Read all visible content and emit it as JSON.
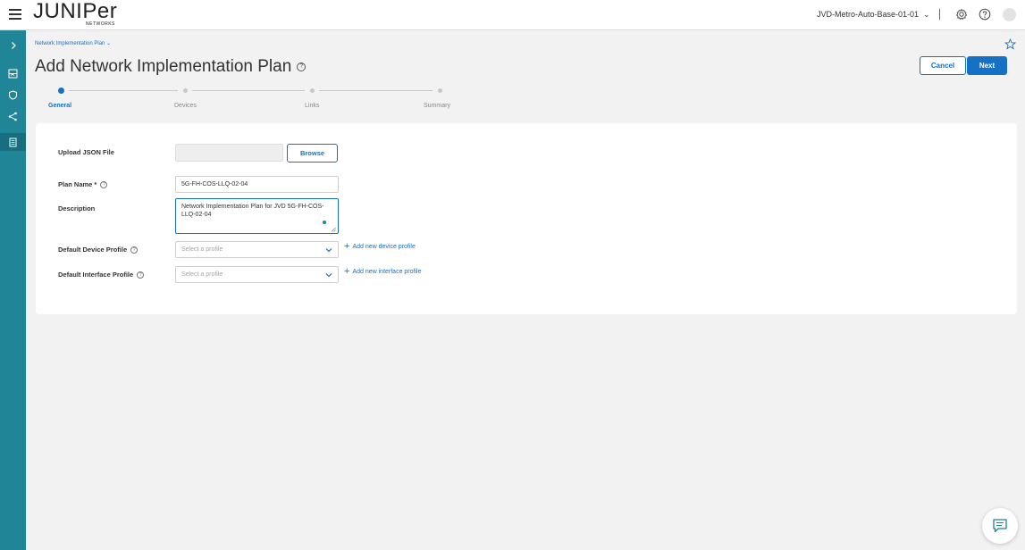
{
  "header": {
    "logo_text": "JUNIPer",
    "logo_sub": "NETWORKS",
    "site_selector": "JVD-Metro-Auto-Base-01-01",
    "icons": [
      "menu-icon",
      "gear-icon",
      "help-icon",
      "avatar"
    ]
  },
  "leftnav": {
    "items": [
      "expand-chevron-icon",
      "dashboard-icon",
      "shield-icon",
      "topology-icon",
      "document-icon"
    ],
    "active_index": 4
  },
  "breadcrumb": "Network Implementation Plan",
  "page": {
    "title": "Add Network Implementation Plan",
    "cancel_label": "Cancel",
    "next_label": "Next"
  },
  "stepper": {
    "steps": [
      "General",
      "Devices",
      "Links",
      "Summary"
    ],
    "active_index": 0
  },
  "form": {
    "upload_label": "Upload JSON File",
    "browse_label": "Browse",
    "plan_name_label": "Plan Name *",
    "plan_name_value": "5G-FH-COS-LLQ-02-04",
    "description_label": "Description",
    "description_value": "Network Implementation Plan for JVD 5G-FH-COS-LLQ-02-04",
    "device_profile_label": "Default Device Profile",
    "device_profile_placeholder": "Select a profile",
    "add_device_profile": "Add new device profile",
    "interface_profile_label": "Default Interface Profile",
    "interface_profile_placeholder": "Select a profile",
    "add_interface_profile": "Add new interface profile"
  },
  "colors": {
    "accent": "#1670c4",
    "nav": "#1f8597",
    "background": "#f2f2f2"
  }
}
